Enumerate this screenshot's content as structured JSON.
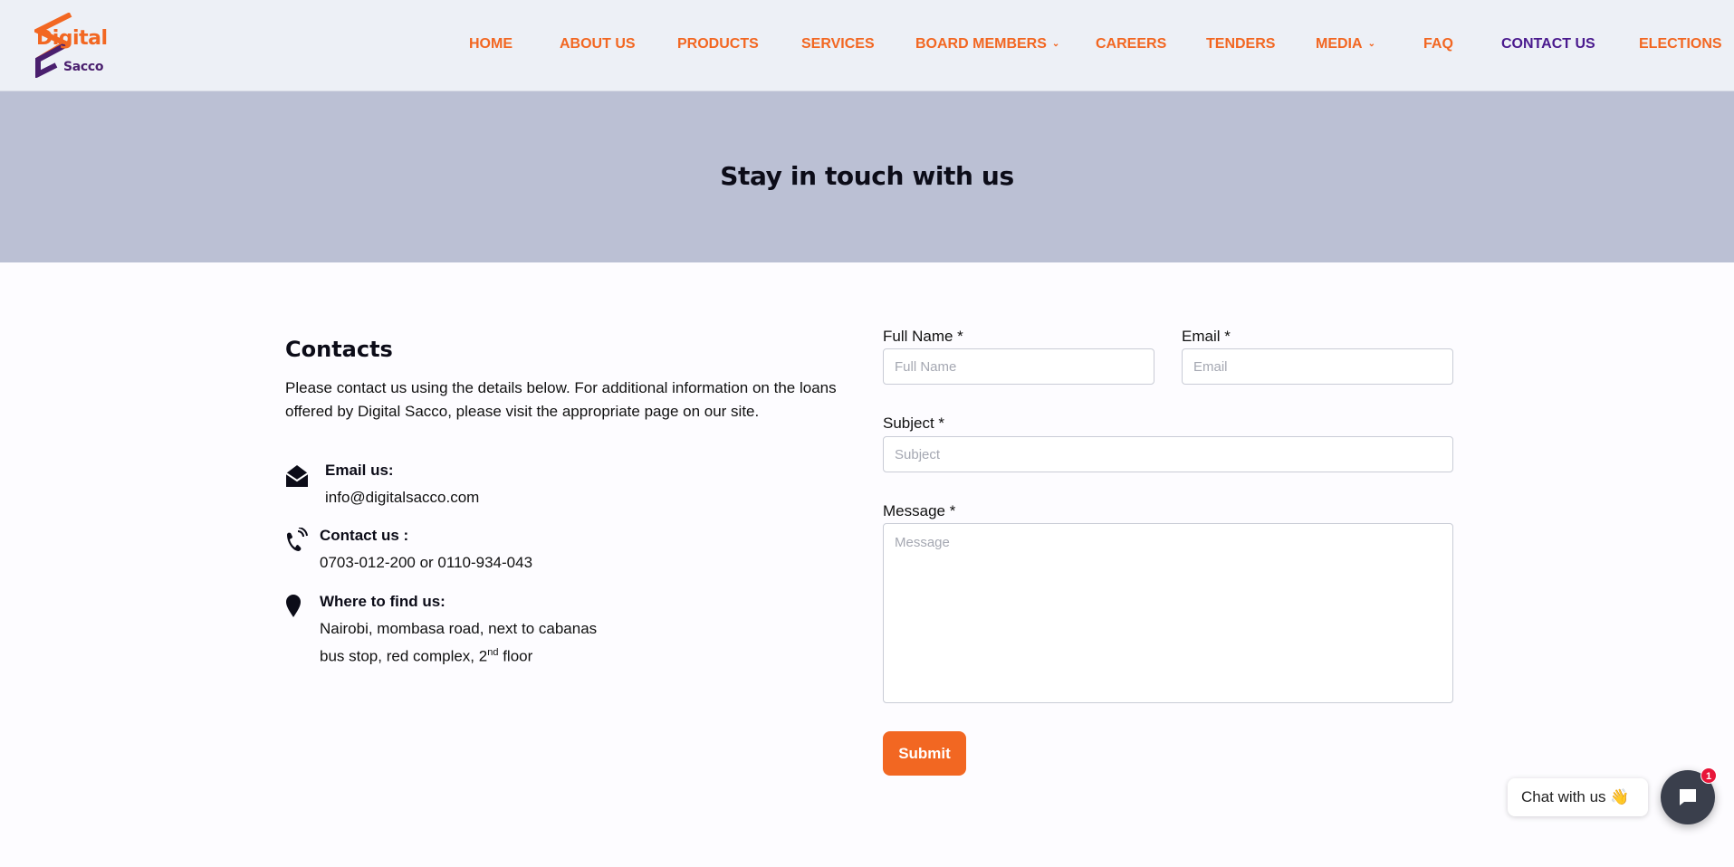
{
  "brand": {
    "name_line1": "Digital",
    "name_line2": "Sacco",
    "orange": "#f26722",
    "purple": "#4a1f6e"
  },
  "nav": {
    "items": [
      {
        "label": "HOME"
      },
      {
        "label": "ABOUT US"
      },
      {
        "label": "PRODUCTS"
      },
      {
        "label": "SERVICES"
      },
      {
        "label": "BOARD MEMBERS",
        "has_dropdown": true
      },
      {
        "label": "CAREERS"
      },
      {
        "label": "TENDERS"
      },
      {
        "label": "MEDIA",
        "has_dropdown": true
      },
      {
        "label": "FAQ"
      },
      {
        "label": "CONTACT US",
        "active": true
      },
      {
        "label": "ELECTIONS"
      }
    ]
  },
  "hero": {
    "title": "Stay in touch with us"
  },
  "contacts": {
    "title": "Contacts",
    "description": "Please contact us using the details below. For additional information on the loans offered by Digital Sacco, please visit the appropriate page on our site.",
    "email": {
      "label": "Email us:",
      "value": "info@digitalsacco.com",
      "icon": "envelope-open-icon"
    },
    "phone": {
      "label": "Contact us :",
      "value": "0703-012-200 or 0110-934-043",
      "icon": "phone-ringing-icon"
    },
    "location": {
      "label": "Where to find us:",
      "line1": "Nairobi, mombasa road, next to cabanas",
      "line2_prefix": "bus stop, red complex, 2",
      "line2_sup": "nd",
      "line2_suffix": " floor",
      "icon": "map-pin-icon"
    }
  },
  "form": {
    "full_name": {
      "label": "Full Name *",
      "placeholder": "Full Name",
      "value": ""
    },
    "email": {
      "label": "Email *",
      "placeholder": "Email",
      "value": ""
    },
    "subject": {
      "label": "Subject *",
      "placeholder": "Subject",
      "value": ""
    },
    "message": {
      "label": "Message *",
      "placeholder": "Message",
      "value": ""
    },
    "submit_label": "Submit"
  },
  "chat": {
    "prompt": "Chat with us",
    "emoji": "👋",
    "badge_count": "1"
  }
}
